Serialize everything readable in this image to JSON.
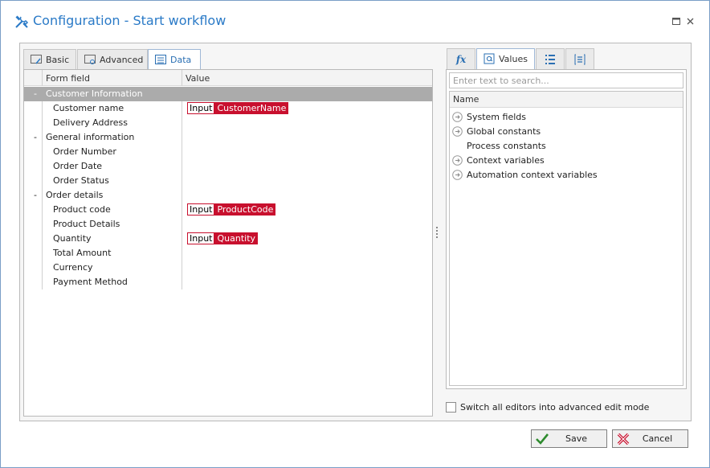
{
  "window": {
    "title": "Configuration - Start workflow"
  },
  "left_tabs": [
    {
      "label": "Basic"
    },
    {
      "label": "Advanced"
    },
    {
      "label": "Data"
    }
  ],
  "grid": {
    "col_field": "Form field",
    "col_value": "Value",
    "rows": [
      {
        "toggle": "-",
        "label": "Customer Information",
        "type": "",
        "value": ""
      },
      {
        "toggle": "",
        "label": "Customer name",
        "type": "Input",
        "value": "CustomerName"
      },
      {
        "toggle": "",
        "label": "Delivery Address",
        "type": "",
        "value": ""
      },
      {
        "toggle": "-",
        "label": "General information",
        "type": "",
        "value": ""
      },
      {
        "toggle": "",
        "label": "Order Number",
        "type": "",
        "value": ""
      },
      {
        "toggle": "",
        "label": "Order Date",
        "type": "",
        "value": ""
      },
      {
        "toggle": "",
        "label": "Order Status",
        "type": "",
        "value": ""
      },
      {
        "toggle": "-",
        "label": "Order details",
        "type": "",
        "value": ""
      },
      {
        "toggle": "",
        "label": "Product code",
        "type": "Input",
        "value": "ProductCode"
      },
      {
        "toggle": "",
        "label": "Product Details",
        "type": "",
        "value": ""
      },
      {
        "toggle": "",
        "label": "Quantity",
        "type": "Input",
        "value": "Quantity"
      },
      {
        "toggle": "",
        "label": "Total Amount",
        "type": "",
        "value": ""
      },
      {
        "toggle": "",
        "label": "Currency",
        "type": "",
        "value": ""
      },
      {
        "toggle": "",
        "label": "Payment Method",
        "type": "",
        "value": ""
      }
    ]
  },
  "right_tabs": [
    {
      "label": "fx"
    },
    {
      "label": "Values"
    },
    {
      "label": ""
    },
    {
      "label": ""
    }
  ],
  "values_panel": {
    "search_placeholder": "Enter text to search...",
    "column_name": "Name",
    "items": [
      {
        "label": "System fields",
        "has_arrow": true
      },
      {
        "label": "Global constants",
        "has_arrow": true
      },
      {
        "label": "Process constants",
        "has_arrow": false
      },
      {
        "label": "Context variables",
        "has_arrow": true
      },
      {
        "label": "Automation context variables",
        "has_arrow": true
      }
    ]
  },
  "advanced_mode": {
    "label": "Switch all editors into advanced edit mode",
    "checked": false
  },
  "buttons": {
    "save": "Save",
    "cancel": "Cancel"
  },
  "colors": {
    "accent": "#2a7ac7",
    "token": "#c8102e"
  }
}
